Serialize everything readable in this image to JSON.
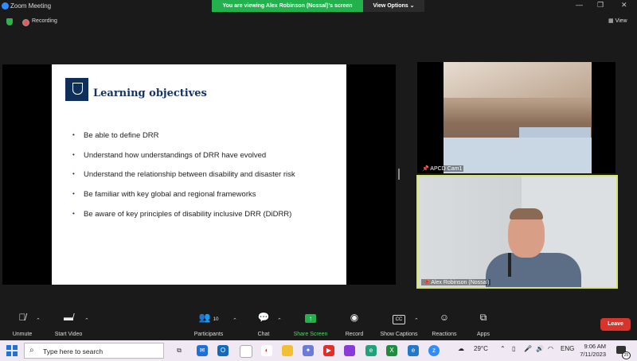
{
  "window": {
    "title": "Zoom Meeting",
    "minimize": "—",
    "restore": "❐",
    "close": "✕"
  },
  "share_banner": {
    "message": "You are viewing Alex Robinson (Nossal)'s screen",
    "options_label": "View Options",
    "options_caret": "⌄"
  },
  "status": {
    "recording_label": "Recording",
    "view_label": "View",
    "view_icon": "grid-icon"
  },
  "slide": {
    "title": "Learning objectives",
    "bullets": [
      "Be able to define DRR",
      "Understand how understandings of DRR have evolved",
      "Understand the relationship between disability and disaster risk",
      "Be familiar with key global and regional frameworks",
      "Be aware of key principles of disability inclusive DRR (DiDRR)"
    ]
  },
  "video_tiles": [
    {
      "name": "APCD Cam1",
      "pinned": true
    },
    {
      "name": "Alex Robinson (Nossal)",
      "pinned": true,
      "active_speaker": true,
      "highlight_color": "#d7e56b"
    }
  ],
  "toolbar": {
    "unmute": "Unmute",
    "start_video": "Start Video",
    "participants": "Participants",
    "participants_count": "10",
    "chat": "Chat",
    "share_screen": "Share Screen",
    "record": "Record",
    "show_captions": "Show Captions",
    "reactions": "Reactions",
    "apps": "Apps",
    "leave": "Leave"
  },
  "taskbar": {
    "search_placeholder": "Type here to search",
    "weather": "29°C",
    "language": "ENG",
    "time": "9:06 AM",
    "date": "7/11/2023",
    "notification_count": "25"
  },
  "colors": {
    "accent_green": "#22b14c",
    "leave_red": "#d9342b",
    "speaker_highlight": "#d7e56b",
    "slide_title": "#15325e"
  }
}
